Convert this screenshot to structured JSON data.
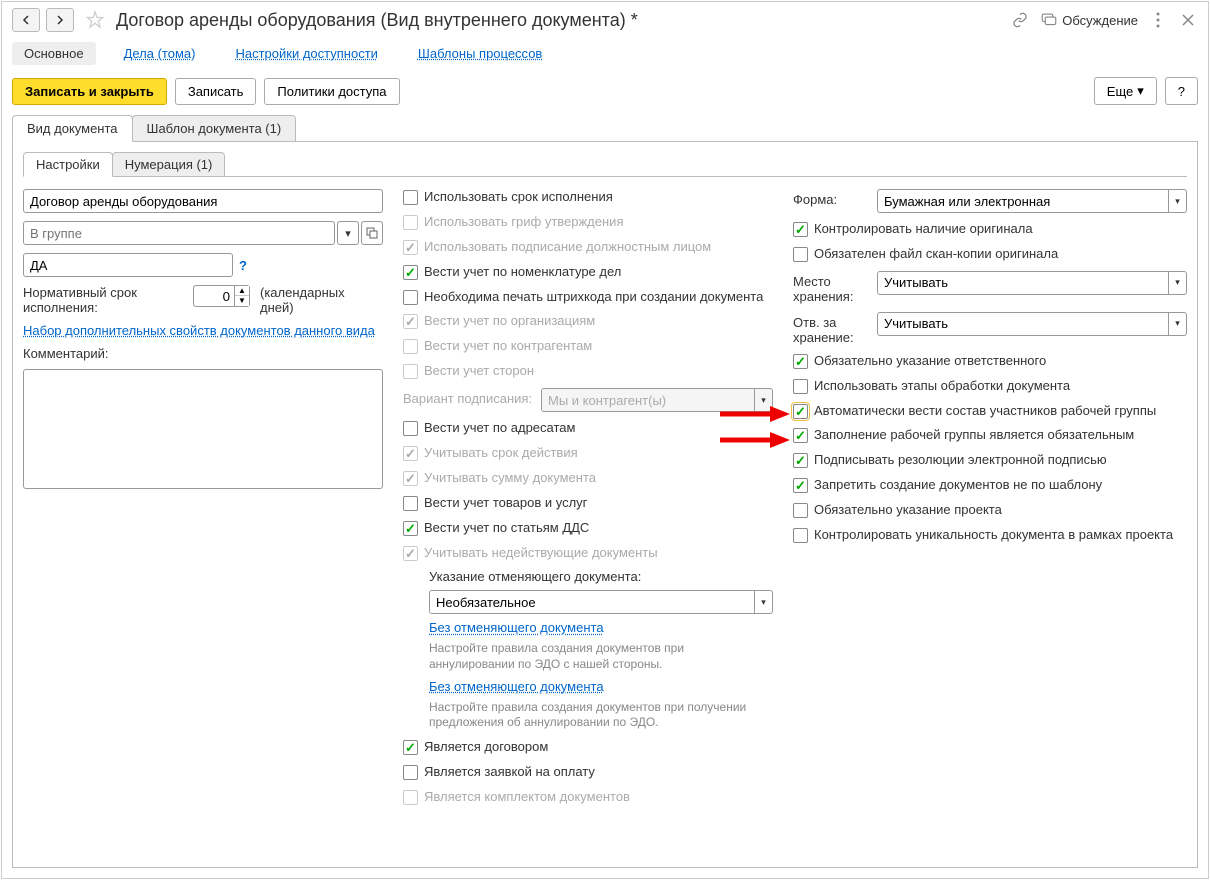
{
  "header": {
    "title": "Договор аренды оборудования (Вид внутреннего документа) *",
    "discuss": "Обсуждение"
  },
  "nav": {
    "main": "Основное",
    "dela": "Дела (тома)",
    "access": "Настройки доступности",
    "templates": "Шаблоны процессов"
  },
  "toolbar": {
    "save_close": "Записать и закрыть",
    "save": "Записать",
    "policies": "Политики доступа",
    "more": "Еще",
    "help": "?"
  },
  "tabs": {
    "doc_type": "Вид документа",
    "doc_template": "Шаблон документа (1)"
  },
  "inner_tabs": {
    "settings": "Настройки",
    "numbering": "Нумерация (1)"
  },
  "col1": {
    "name_value": "Договор аренды оборудования",
    "group_placeholder": "В группе",
    "code_value": "ДА",
    "norm_label": "Нормативный срок исполнения:",
    "norm_value": "0",
    "norm_unit": "(календарных дней)",
    "props_link": "Набор дополнительных свойств документов данного вида",
    "comment_label": "Комментарий:"
  },
  "col2": {
    "use_deadline": "Использовать срок исполнения",
    "use_grif": "Использовать гриф утверждения",
    "use_signing": "Использовать подписание должностным лицом",
    "nomenclature": "Вести учет по номенклатуре дел",
    "barcode": "Необходима печать штрихкода при создании документа",
    "by_org": "Вести учет по организациям",
    "by_counter": "Вести учет по контрагентам",
    "by_sides": "Вести учет сторон",
    "sign_variant_label": "Вариант подписания:",
    "sign_variant_value": "Мы и контрагент(ы)",
    "by_addressee": "Вести учет по адресатам",
    "account_validity": "Учитывать срок действия",
    "account_sum": "Учитывать сумму документа",
    "goods_services": "Вести учет товаров и услуг",
    "by_dds": "Вести учет по статьям ДДС",
    "account_inactive": "Учитывать недействующие документы",
    "cancel_doc_label": "Указание отменяющего документа:",
    "cancel_doc_value": "Необязательное",
    "cancel_link1": "Без отменяющего документа",
    "cancel_hint1": "Настройте правила создания документов при аннулировании по ЭДО с нашей стороны.",
    "cancel_link2": "Без отменяющего документа",
    "cancel_hint2": "Настройте правила создания документов при получении предложения об аннулировании по ЭДО.",
    "is_contract": "Является договором",
    "is_payment": "Является заявкой на оплату",
    "is_docset": "Является комплектом документов"
  },
  "col3": {
    "form_label": "Форма:",
    "form_value": "Бумажная или электронная",
    "control_original": "Контролировать наличие оригинала",
    "scan_required": "Обязателен файл скан-копии оригинала",
    "storage_label": "Место хранения:",
    "storage_value": "Учитывать",
    "resp_storage_label": "Отв. за хранение:",
    "resp_storage_value": "Учитывать",
    "resp_required": "Обязательно указание ответственного",
    "use_stages": "Использовать этапы обработки документа",
    "auto_workgroup": "Автоматически вести состав участников рабочей группы",
    "workgroup_required": "Заполнение рабочей группы является обязательным",
    "sign_resolution": "Подписывать резолюции электронной подписью",
    "template_only": "Запретить создание документов не по шаблону",
    "project_required": "Обязательно указание проекта",
    "unique_in_project": "Контролировать уникальность документа в рамках проекта"
  }
}
